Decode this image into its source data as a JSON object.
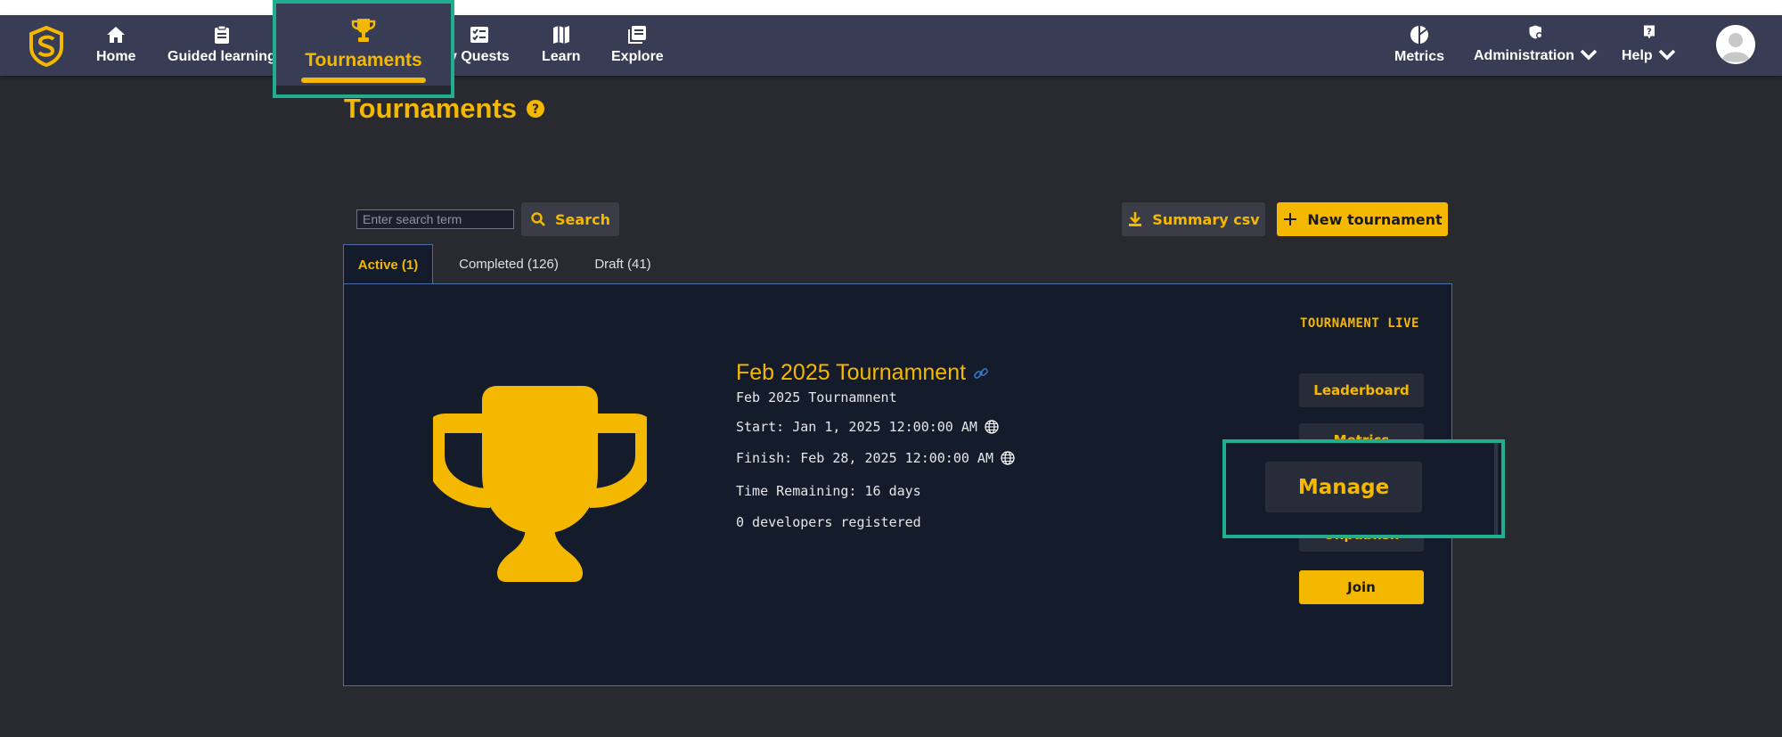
{
  "nav": {
    "items": [
      {
        "label": "Home",
        "icon": "home-icon"
      },
      {
        "label": "Guided learning",
        "icon": "clipboard-icon"
      },
      {
        "label": "y Quests",
        "icon": "checklist-icon"
      },
      {
        "label": "Learn",
        "icon": "book-icon"
      },
      {
        "label": "Explore",
        "icon": "library-icon"
      }
    ],
    "right_items": [
      {
        "label": "Metrics",
        "icon": "pie-chart-icon"
      },
      {
        "label": "Administration",
        "icon": "shield-gear-icon"
      },
      {
        "label": "Help",
        "icon": "question-icon"
      }
    ],
    "active_tab": {
      "label": "Tournaments",
      "icon": "trophy-icon"
    }
  },
  "page": {
    "title": "Tournaments"
  },
  "toolbar": {
    "search_placeholder": "Enter search term",
    "search_label": "Search",
    "summary_label": "Summary csv",
    "new_label": "New tournament"
  },
  "tabs": [
    {
      "label": "Active (1)",
      "active": true
    },
    {
      "label": "Completed (126)",
      "active": false
    },
    {
      "label": "Draft (41)",
      "active": false
    }
  ],
  "tournament": {
    "title": "Feb 2025 Tournamnent",
    "subtitle": "Feb 2025 Tournamnent",
    "start": "Start: Jan 1, 2025 12:00:00 AM",
    "finish": "Finish: Feb 28, 2025 12:00:00 AM",
    "remaining": "Time Remaining: 16 days",
    "registered": "0 developers registered",
    "status": "TOURNAMENT LIVE",
    "actions": {
      "leaderboard": "Leaderboard",
      "metrics": "Metrics",
      "manage": "Manage",
      "unpublish": "Unpublish",
      "join": "Join"
    }
  },
  "colors": {
    "accent": "#f5b800",
    "navbar": "#383c55",
    "background": "#282a30",
    "panel": "#141b2b",
    "highlight": "#1fae8f"
  }
}
